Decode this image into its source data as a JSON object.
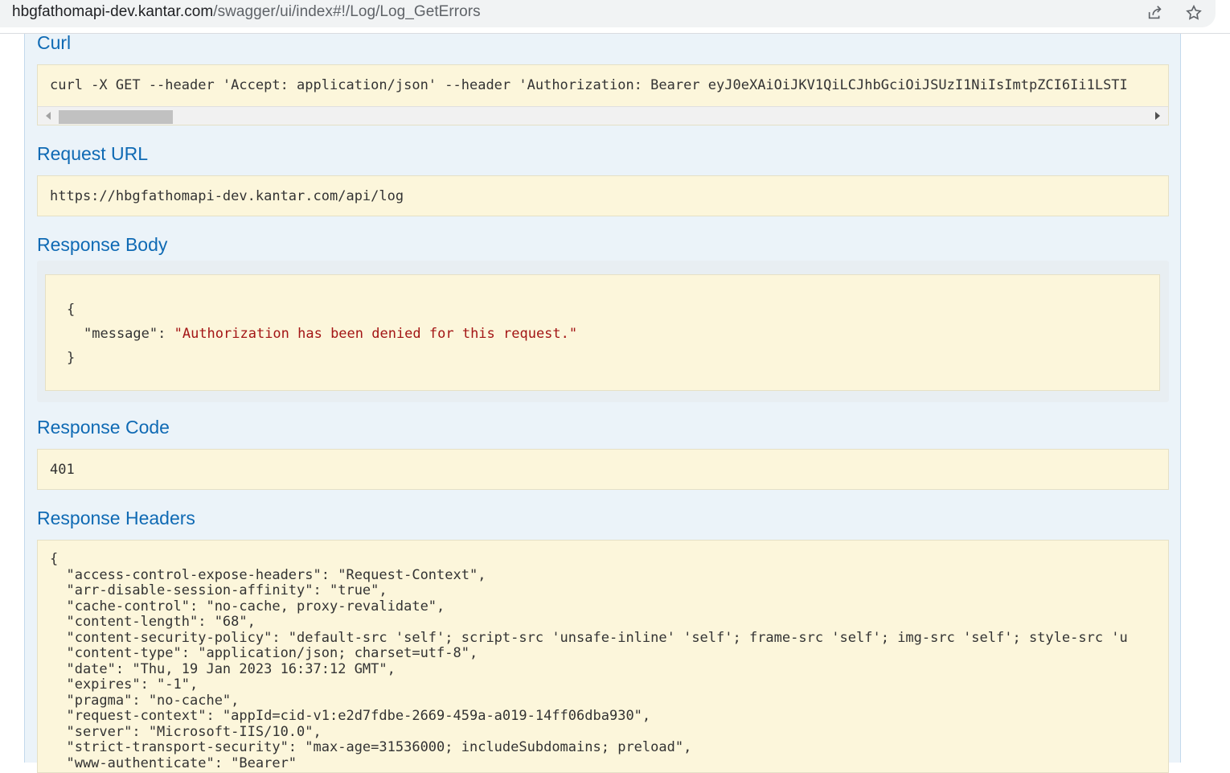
{
  "browser": {
    "url_host": "hbgfathomapi-dev.kantar.com",
    "url_path": "/swagger/ui/index#!/Log/Log_GetErrors",
    "share_icon": "share-icon",
    "bookmark_icon": "star-icon"
  },
  "curl": {
    "title": "Curl",
    "command": "curl -X GET --header 'Accept: application/json' --header 'Authorization: Bearer eyJ0eXAiOiJKV1QiLCJhbGciOiJSUzI1NiIsImtpZCI6Ii1LSTI"
  },
  "request_url": {
    "title": "Request URL",
    "value": "https://hbgfathomapi-dev.kantar.com/api/log"
  },
  "response_body": {
    "title": "Response Body",
    "open_brace": "{",
    "key": "\"message\"",
    "colon": ": ",
    "value": "\"Authorization has been denied for this request.\"",
    "close_brace": "}"
  },
  "response_code": {
    "title": "Response Code",
    "value": "401"
  },
  "response_headers": {
    "title": "Response Headers",
    "lines": [
      "{",
      "  \"access-control-expose-headers\": \"Request-Context\",",
      "  \"arr-disable-session-affinity\": \"true\",",
      "  \"cache-control\": \"no-cache, proxy-revalidate\",",
      "  \"content-length\": \"68\",",
      "  \"content-security-policy\": \"default-src 'self'; script-src 'unsafe-inline' 'self'; frame-src 'self'; img-src 'self'; style-src 'u",
      "  \"content-type\": \"application/json; charset=utf-8\",",
      "  \"date\": \"Thu, 19 Jan 2023 16:37:12 GMT\",",
      "  \"expires\": \"-1\",",
      "  \"pragma\": \"no-cache\",",
      "  \"request-context\": \"appId=cid-v1:e2d7fdbe-2669-459a-a019-14ff06dba930\",",
      "  \"server\": \"Microsoft-IIS/10.0\",",
      "  \"strict-transport-security\": \"max-age=31536000; includeSubdomains; preload\",",
      "  \"www-authenticate\": \"Bearer\""
    ]
  }
}
